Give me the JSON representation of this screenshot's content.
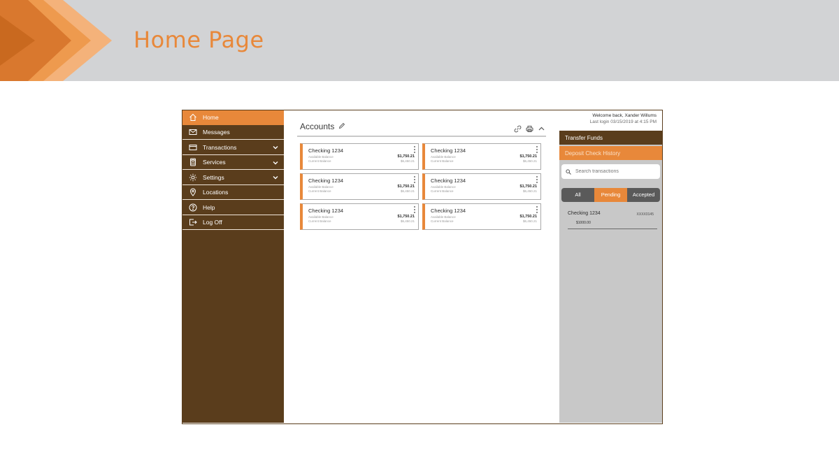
{
  "slide": {
    "title": "Home Page"
  },
  "colors": {
    "brand_brown": "#5a3d1c",
    "accent_orange": "#e8883a",
    "header_gray": "#d2d3d5",
    "panel_gray": "#c8c8c8"
  },
  "sidebar": {
    "items": [
      {
        "label": "Home",
        "icon": "home-icon",
        "active": true
      },
      {
        "label": "Messages",
        "icon": "envelope-icon"
      },
      {
        "label": "Transactions",
        "icon": "card-icon",
        "expandable": true
      },
      {
        "label": "Services",
        "icon": "calculator-icon",
        "expandable": true
      },
      {
        "label": "Settings",
        "icon": "gear-icon",
        "expandable": true
      },
      {
        "label": "Locations",
        "icon": "map-pin-icon"
      },
      {
        "label": "Help",
        "icon": "question-icon"
      },
      {
        "label": "Log Off",
        "icon": "logout-icon"
      }
    ]
  },
  "main": {
    "title": "Accounts",
    "accounts": [
      {
        "name": "Checking 1234",
        "available_label": "Available Balance",
        "current_label": "Current Balance",
        "available": "$1,750.21",
        "current": "$6,450.21"
      },
      {
        "name": "Checking 1234",
        "available_label": "Available Balance",
        "current_label": "Current Balance",
        "available": "$1,750.21",
        "current": "$6,450.21"
      },
      {
        "name": "Checking 1234",
        "available_label": "Available Balance",
        "current_label": "Current Balance",
        "available": "$1,750.21",
        "current": "$6,450.21"
      },
      {
        "name": "Checking 1234",
        "available_label": "Available Balance",
        "current_label": "Current Balance",
        "available": "$1,750.21",
        "current": "$6,450.21"
      },
      {
        "name": "Checking 1234",
        "available_label": "Available Balance",
        "current_label": "Current Balance",
        "available": "$1,750.21",
        "current": "$6,450.21"
      },
      {
        "name": "Checking 1234",
        "available_label": "Available Balance",
        "current_label": "Current Balance",
        "available": "$1,750.21",
        "current": "$6,450.21"
      }
    ]
  },
  "right_panel": {
    "welcome": "Welcome back, Xander Willums",
    "last_login": "Last login 03/15/2019 at 4:15 PM",
    "transfer_label": "Transfer Funds",
    "deposit_label": "Deposit Check History",
    "search_placeholder": "Search transactions",
    "filters": [
      "All",
      "Pending",
      "Accepted"
    ],
    "active_filter": "Pending",
    "transaction": {
      "name": "Checking 1234",
      "account": "XXXX0145",
      "amount": "$1000.00"
    }
  }
}
